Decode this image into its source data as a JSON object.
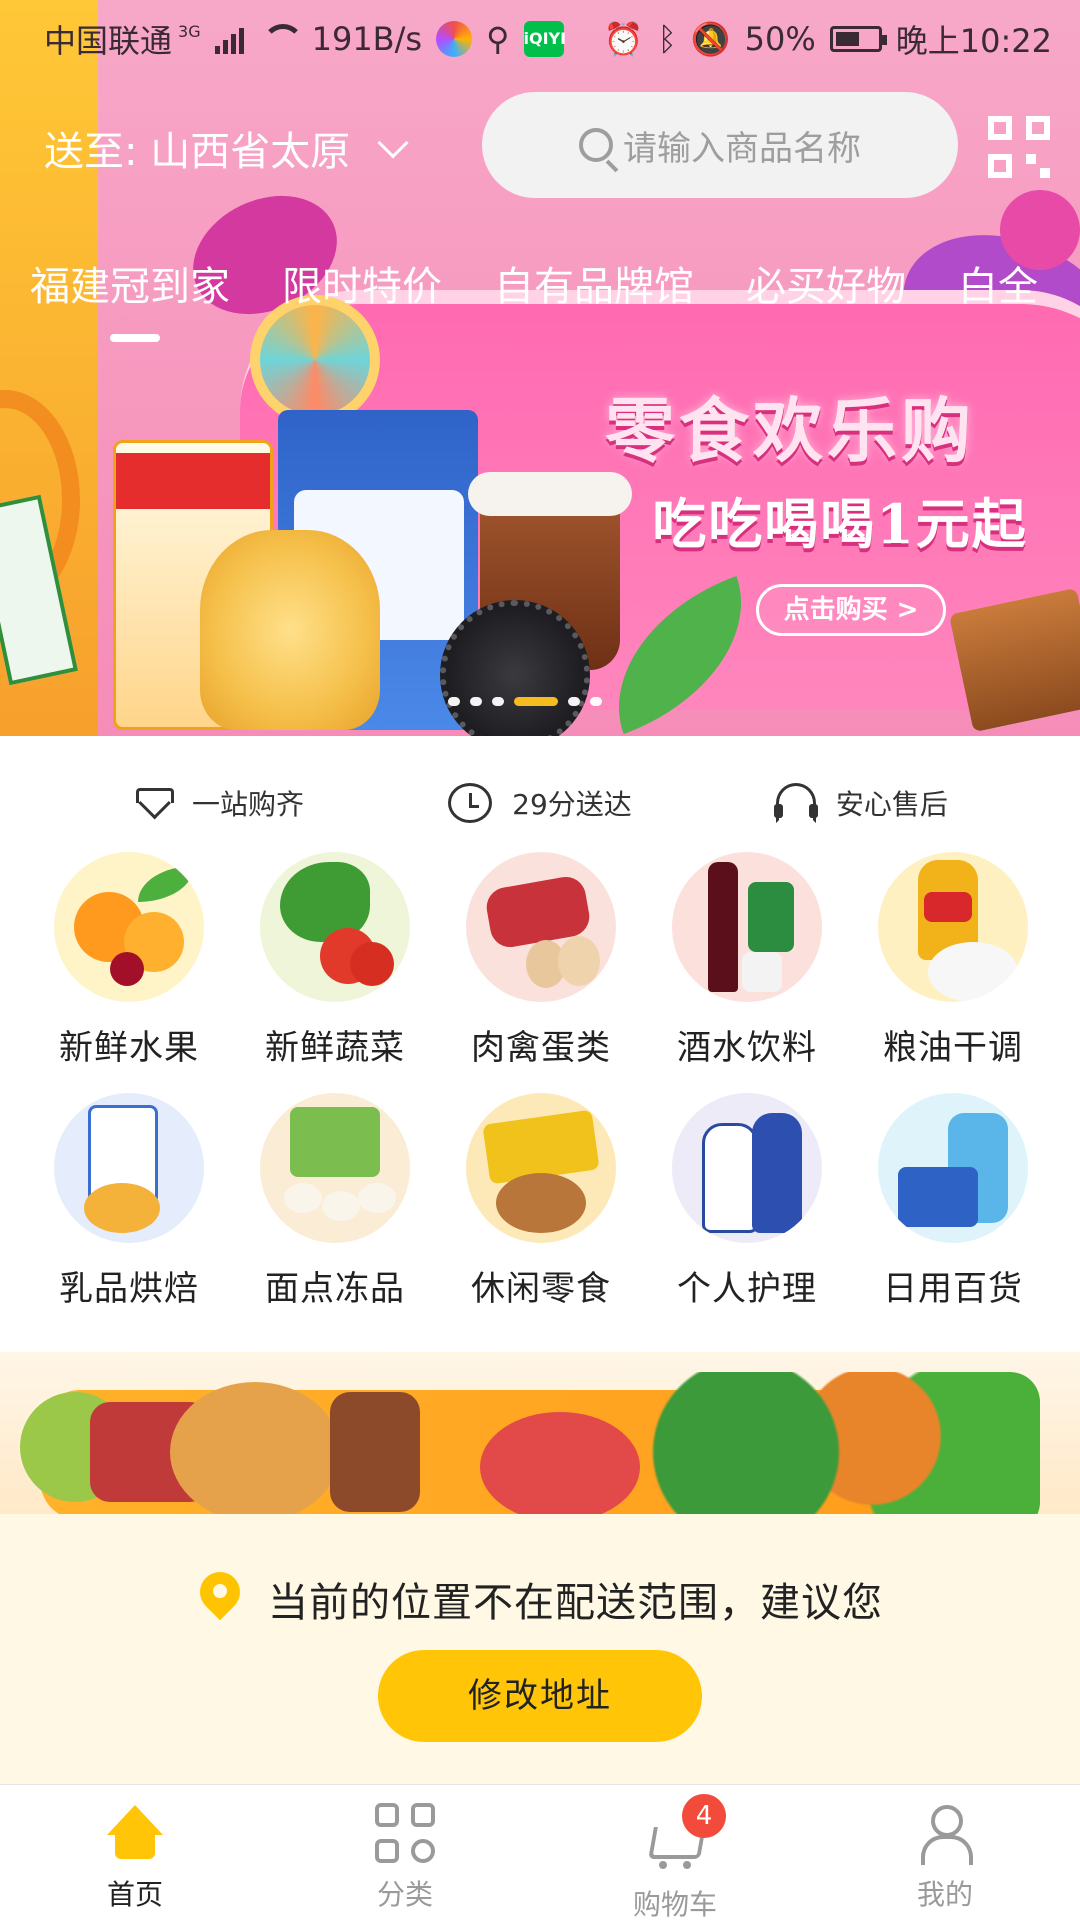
{
  "status_bar": {
    "carrier": "中国联通",
    "network": "3G",
    "speed": "191B/s",
    "battery": "50%",
    "time": "晚上10:22",
    "icons": [
      "signal-icon",
      "wifi-icon",
      "browser-app-icon",
      "usb-icon",
      "iqiyi-app-icon",
      "alarm-icon",
      "bluetooth-icon",
      "mute-icon",
      "battery-icon"
    ],
    "iqiyi_label": "iQIYI"
  },
  "header": {
    "location": "送至: 山西省太原",
    "search_placeholder": "请输入商品名称"
  },
  "tabs": [
    {
      "label": "福建冠到家",
      "active": true
    },
    {
      "label": "限时特价"
    },
    {
      "label": "自有品牌馆"
    },
    {
      "label": "必买好物"
    },
    {
      "label": "白全"
    }
  ],
  "banner": {
    "title": "零食欢乐购",
    "subtitle": "吃吃喝喝1元起",
    "button": "点击购买 >",
    "dot_count": 6,
    "active_dot": 4
  },
  "features": [
    {
      "icon": "diamond-icon",
      "label": "一站购齐"
    },
    {
      "icon": "clock-delivery-icon",
      "label": "29分送达"
    },
    {
      "icon": "headset-icon",
      "label": "安心售后"
    }
  ],
  "categories": [
    {
      "label": "新鲜水果",
      "icon": "fruit-icon"
    },
    {
      "label": "新鲜蔬菜",
      "icon": "vegetable-icon"
    },
    {
      "label": "肉禽蛋类",
      "icon": "meat-egg-icon"
    },
    {
      "label": "酒水饮料",
      "icon": "drinks-icon"
    },
    {
      "label": "粮油干调",
      "icon": "grain-oil-icon"
    },
    {
      "label": "乳品烘焙",
      "icon": "dairy-bakery-icon"
    },
    {
      "label": "面点冻品",
      "icon": "frozen-food-icon"
    },
    {
      "label": "休闲零食",
      "icon": "snack-icon"
    },
    {
      "label": "个人护理",
      "icon": "personal-care-icon"
    },
    {
      "label": "日用百货",
      "icon": "household-icon"
    }
  ],
  "notice": {
    "message": "当前的位置不在配送范围，建议您",
    "button": "修改地址"
  },
  "bottom_nav": [
    {
      "label": "首页",
      "icon": "home-icon",
      "active": true
    },
    {
      "label": "分类",
      "icon": "category-grid-icon"
    },
    {
      "label": "购物车",
      "icon": "cart-icon",
      "badge": "4"
    },
    {
      "label": "我的",
      "icon": "user-icon"
    }
  ],
  "colors": {
    "accent": "#ffc506",
    "badge": "#f24b3b",
    "banner_pink": "#f79ac0"
  }
}
